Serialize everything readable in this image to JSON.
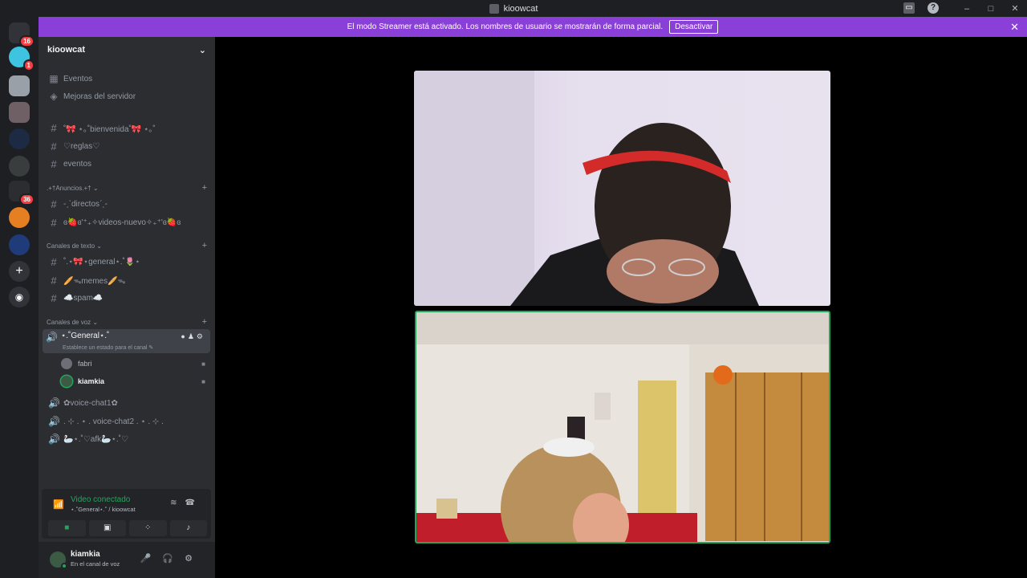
{
  "window": {
    "title": "kioowcat"
  },
  "banner": {
    "message": "El modo Streamer está activado. Los nombres de usuario se mostrarán de forma parcial.",
    "button": "Desactivar"
  },
  "guilds": [
    {
      "name": "direct-messages",
      "badge": "16"
    },
    {
      "name": "server-blue",
      "badge": "1"
    },
    {
      "name": "server-2",
      "badge": ""
    },
    {
      "name": "server-3",
      "badge": ""
    },
    {
      "name": "server-4",
      "badge": ""
    },
    {
      "name": "server-5",
      "badge": ""
    },
    {
      "name": "server-6",
      "badge": "36"
    },
    {
      "name": "server-7",
      "badge": ""
    },
    {
      "name": "server-8",
      "badge": ""
    }
  ],
  "server": {
    "name": "kioowcat"
  },
  "top_items": [
    {
      "label": "Eventos"
    },
    {
      "label": "Mejoras del servidor"
    }
  ],
  "channels_top": [
    "˚🎀 ⋆｡˚bienvenida˚🎀 ⋆｡˚",
    "♡reglas♡",
    "eventos"
  ],
  "categories": {
    "anuncios": ".+†Anuncios.+†",
    "texto": "Canales de texto",
    "voz": "Canales de voz"
  },
  "channels_anuncios": [
    "-ˏˋdirectosˊˎ-",
    "ɞ🍓ɞ'⁺₊✧videos-nuevo✧₊⁺'ɞ🍓ɞ"
  ],
  "channels_texto": [
    "˚.⋆🎀⋆general⋆.˚🌷⋆",
    "🥖ᯓmemes🥖ᯓ",
    "☁️spam☁️"
  ],
  "voice_active": {
    "label": "⋆.˚General⋆.˚",
    "sub": "Establece un estado para el canal"
  },
  "voice_members": [
    {
      "name": "fabri"
    },
    {
      "name": "kiamkia"
    }
  ],
  "channels_voz": [
    "✿voice-chat1✿",
    ". ⊹ . ⋆ . voice-chat2 . ⋆ . ⊹ .",
    "🦢⋆.˚♡afk🦢⋆.˚♡"
  ],
  "voice_panel": {
    "status": "Video conectado",
    "channel": "⋆.˚General⋆.˚ / kioowcat"
  },
  "user": {
    "name": "kiamkia",
    "status": "En el canal de voz"
  }
}
